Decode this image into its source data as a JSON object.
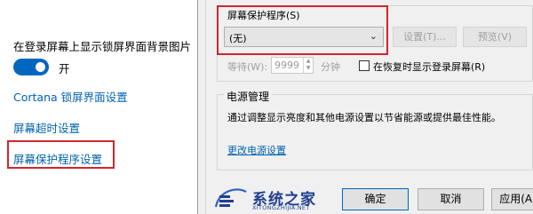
{
  "left_panel": {
    "lockscreen_bg_label": "在登录屏幕上显示锁屏界面背景图片",
    "toggle": {
      "state": "on",
      "label": "开"
    },
    "cortana_link": "Cortana 锁屏界面设置",
    "screen_timeout_link": "屏幕超时设置",
    "screensaver_link": "屏幕保护程序设置"
  },
  "dialog": {
    "screensaver_group_label": "屏幕保护程序(S)",
    "screensaver_select": {
      "value": "(无)"
    },
    "settings_button": "设置(T)...",
    "preview_button": "预览(V)",
    "wait_label": "等待(W):",
    "wait_value": "9999",
    "wait_unit": "分钟",
    "resume_checkbox_label": "在恢复时显示登录屏幕(R)",
    "resume_checked": false,
    "power_group_title": "电源管理",
    "power_desc": "通过调整显示亮度和其他电源设置以节省能源或提供最佳性能。",
    "power_link": "更改电源设置",
    "ok_button": "确定",
    "cancel_button": "取消",
    "apply_button": "应用(A)"
  },
  "watermark": {
    "brand": "系统之家",
    "domain": "XITONGZHIJIA.NET"
  },
  "colors": {
    "accent": "#0067c0",
    "link": "#0063b1",
    "highlight_red": "#d0262c"
  }
}
